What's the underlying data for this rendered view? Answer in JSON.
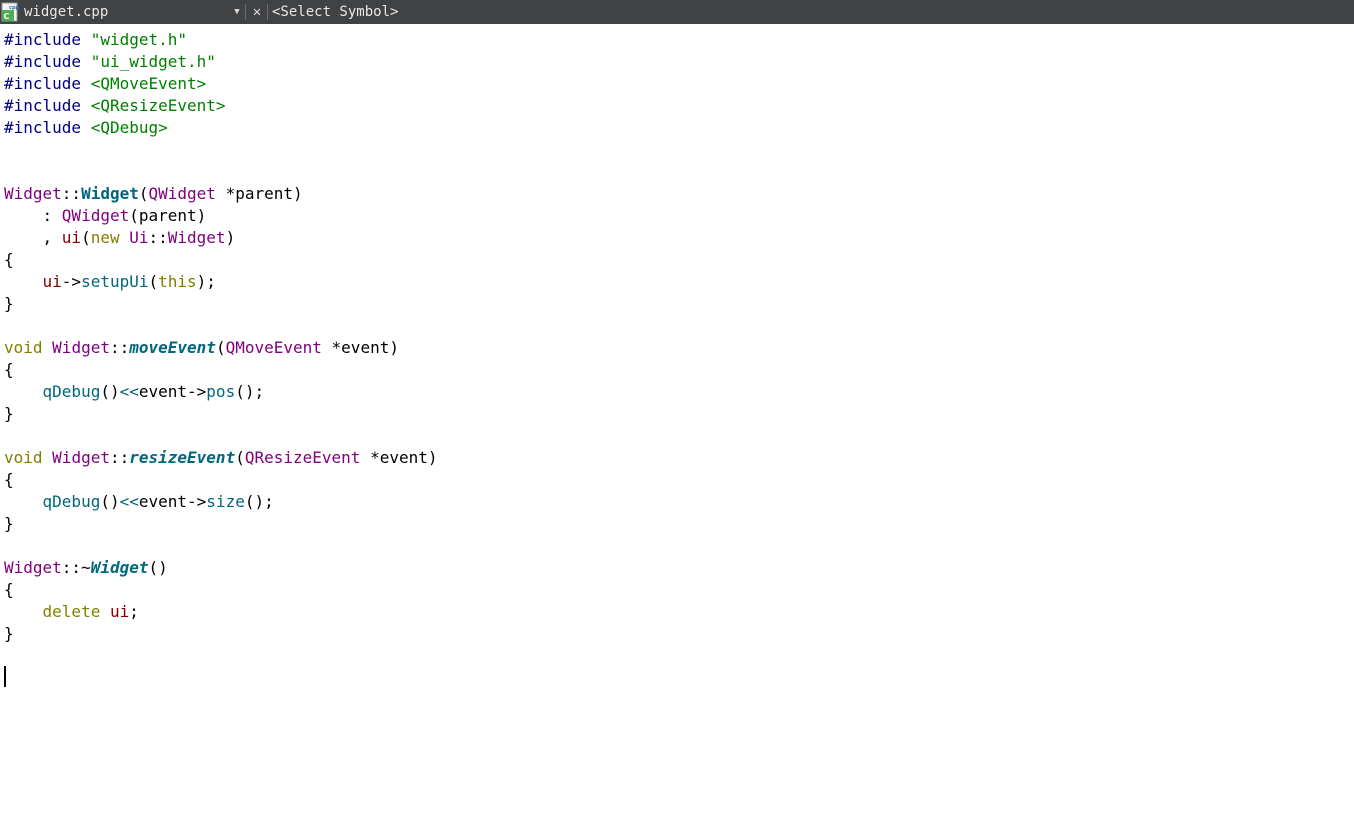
{
  "toolbar": {
    "file_icon": "cpp-file-icon",
    "file_name": "widget.cpp",
    "dropdown_glyph": "▼",
    "close_glyph": "✕",
    "symbol_placeholder": "<Select Symbol>"
  },
  "code": {
    "lines": [
      [
        {
          "t": "#include ",
          "c": "pp"
        },
        {
          "t": "\"widget.h\"",
          "c": "str"
        }
      ],
      [
        {
          "t": "#include ",
          "c": "pp"
        },
        {
          "t": "\"ui_widget.h\"",
          "c": "str"
        }
      ],
      [
        {
          "t": "#include ",
          "c": "pp"
        },
        {
          "t": "<QMoveEvent>",
          "c": "str"
        }
      ],
      [
        {
          "t": "#include ",
          "c": "pp"
        },
        {
          "t": "<QResizeEvent>",
          "c": "str"
        }
      ],
      [
        {
          "t": "#include ",
          "c": "pp"
        },
        {
          "t": "<QDebug>",
          "c": "str"
        }
      ],
      [],
      [],
      [
        {
          "t": "Widget",
          "c": "typ"
        },
        {
          "t": "::"
        },
        {
          "t": "Widget",
          "c": "decl"
        },
        {
          "t": "("
        },
        {
          "t": "QWidget",
          "c": "typ"
        },
        {
          "t": " *parent)"
        }
      ],
      [
        {
          "t": "    : "
        },
        {
          "t": "QWidget",
          "c": "typ"
        },
        {
          "t": "(parent)"
        }
      ],
      [
        {
          "t": "    , "
        },
        {
          "t": "ui",
          "c": "mem"
        },
        {
          "t": "("
        },
        {
          "t": "new ",
          "c": "kw"
        },
        {
          "t": "Ui",
          "c": "typ"
        },
        {
          "t": "::"
        },
        {
          "t": "Widget",
          "c": "typ"
        },
        {
          "t": ")"
        }
      ],
      [
        {
          "t": "{"
        }
      ],
      [
        {
          "t": "    "
        },
        {
          "t": "ui",
          "c": "mem"
        },
        {
          "t": "->"
        },
        {
          "t": "setupUi",
          "c": "fn"
        },
        {
          "t": "("
        },
        {
          "t": "this",
          "c": "kw"
        },
        {
          "t": ");"
        }
      ],
      [
        {
          "t": "}"
        }
      ],
      [],
      [
        {
          "t": "void ",
          "c": "kw"
        },
        {
          "t": "Widget",
          "c": "typ"
        },
        {
          "t": "::"
        },
        {
          "t": "moveEvent",
          "c": "decli"
        },
        {
          "t": "("
        },
        {
          "t": "QMoveEvent",
          "c": "typ"
        },
        {
          "t": " *event)"
        }
      ],
      [
        {
          "t": "{"
        }
      ],
      [
        {
          "t": "    "
        },
        {
          "t": "qDebug",
          "c": "fn"
        },
        {
          "t": "()"
        },
        {
          "t": "<<",
          "c": "fn"
        },
        {
          "t": "event->"
        },
        {
          "t": "pos",
          "c": "fn"
        },
        {
          "t": "();"
        }
      ],
      [
        {
          "t": "}"
        }
      ],
      [],
      [
        {
          "t": "void ",
          "c": "kw"
        },
        {
          "t": "Widget",
          "c": "typ"
        },
        {
          "t": "::"
        },
        {
          "t": "resizeEvent",
          "c": "decli"
        },
        {
          "t": "("
        },
        {
          "t": "QResizeEvent",
          "c": "typ"
        },
        {
          "t": " *event)"
        }
      ],
      [
        {
          "t": "{"
        }
      ],
      [
        {
          "t": "    "
        },
        {
          "t": "qDebug",
          "c": "fn"
        },
        {
          "t": "()"
        },
        {
          "t": "<<",
          "c": "fn"
        },
        {
          "t": "event->"
        },
        {
          "t": "size",
          "c": "fn"
        },
        {
          "t": "();"
        }
      ],
      [
        {
          "t": "}"
        }
      ],
      [],
      [
        {
          "t": "Widget",
          "c": "typ"
        },
        {
          "t": "::~"
        },
        {
          "t": "Widget",
          "c": "decli"
        },
        {
          "t": "()"
        }
      ],
      [
        {
          "t": "{"
        }
      ],
      [
        {
          "t": "    "
        },
        {
          "t": "delete ",
          "c": "kw"
        },
        {
          "t": "ui",
          "c": "mem"
        },
        {
          "t": ";"
        }
      ],
      [
        {
          "t": "}"
        }
      ],
      [],
      []
    ]
  }
}
